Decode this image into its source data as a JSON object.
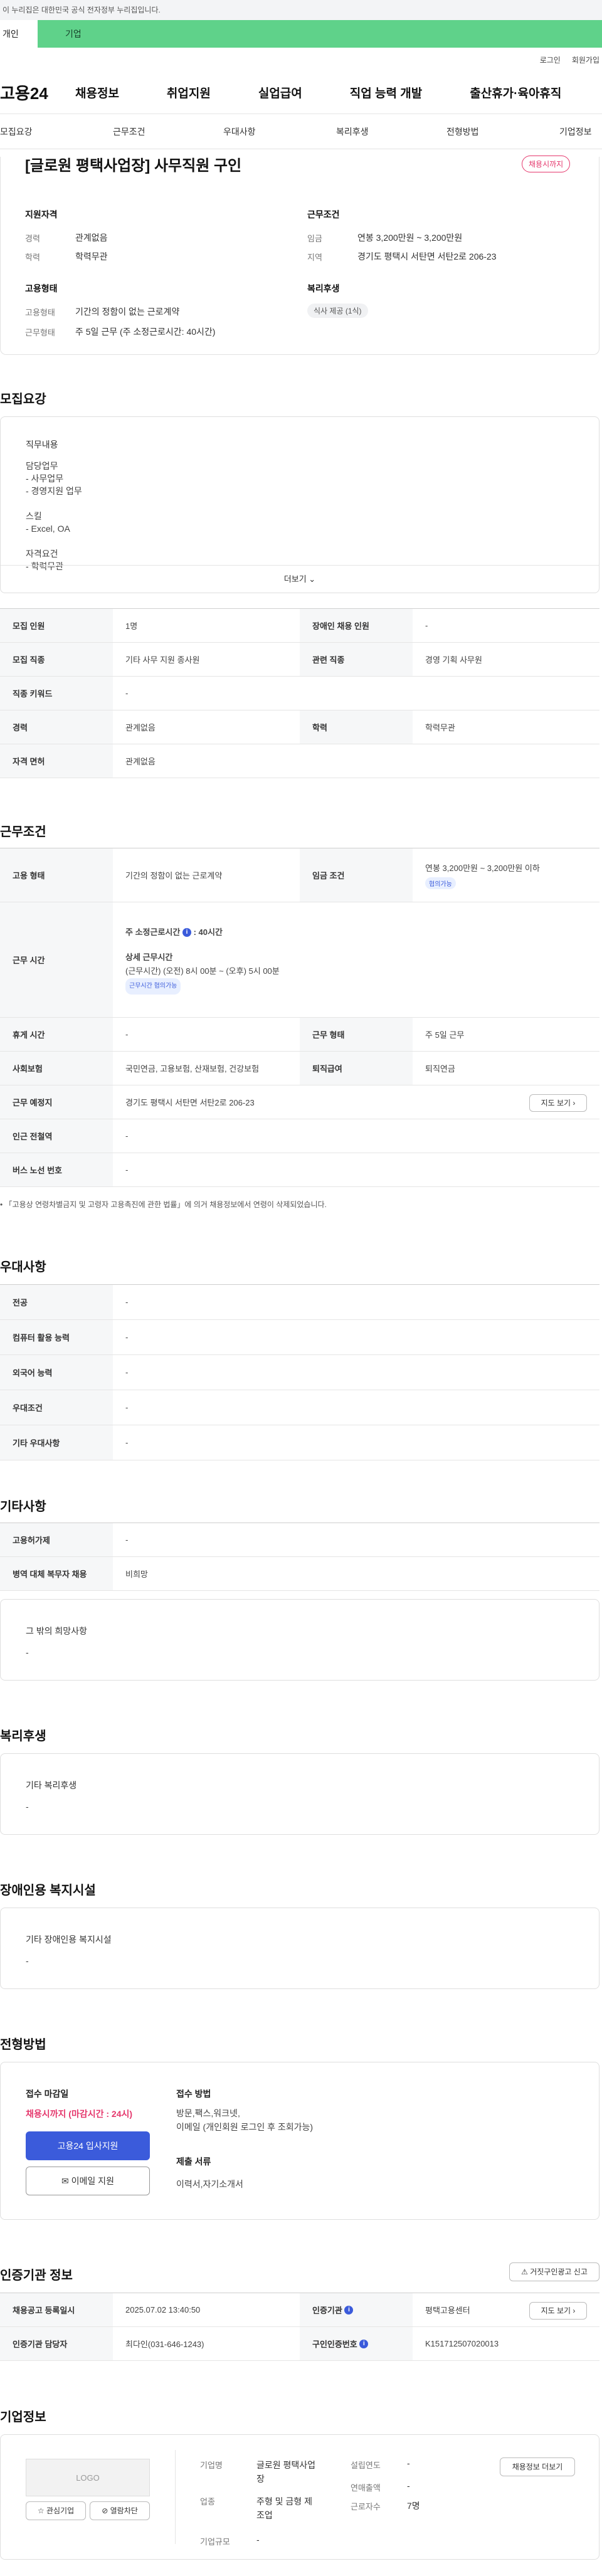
{
  "gov_text": "이 누리집은 대한민국 공식 전자정부 누리집입니다.",
  "tabs": {
    "personal": "개인",
    "company": "기업"
  },
  "util": {
    "login": "로그인",
    "join": "회원가입"
  },
  "site_logo": "고용24",
  "gnb": [
    "채용정보",
    "취업지원",
    "실업급여",
    "직업 능력 개발",
    "출산휴가·육아휴직"
  ],
  "snb": [
    "모집요강",
    "근무조건",
    "우대사항",
    "복리후생",
    "전형방법",
    "기업정보"
  ],
  "job_title": "[글로원 평택사업장] 사무직원 구인",
  "status_badge": "채용시까지",
  "summary": {
    "qual_title": "지원자격",
    "career_k": "경력",
    "career_v": "관계없음",
    "edu_k": "학력",
    "edu_v": "학력무관",
    "cond_title": "근무조건",
    "wage_k": "임금",
    "wage_v": "연봉 3,200만원 ~ 3,200만원",
    "area_k": "지역",
    "area_v": "경기도 평택시 서탄면 서탄2로 206-23",
    "emp_title": "고용형태",
    "emptype_k": "고용형태",
    "emptype_v": "기간의 정함이 없는 근로계약",
    "worktype_k": "근무형태",
    "worktype_v": "주 5일 근무 (주 소정근로시간: 40시간)",
    "welfare_title": "복리후생",
    "welfare_chip": "식사 제공 (1식)"
  },
  "recruit": {
    "title": "모집요강",
    "desc_title": "직무내용",
    "desc_lines": [
      "담당업무",
      "- 사무업무",
      "- 경영지원 업무",
      "",
      "스킬",
      "- Excel, OA",
      "",
      "자격요건",
      "- 학력무관"
    ],
    "more": "더보기",
    "rows": [
      [
        "모집 인원",
        "1명",
        "장애인 채용 인원",
        "-"
      ],
      [
        "모집 직종",
        "기타 사무 지원 종사원",
        "관련 직종",
        "경영 기획 사무원"
      ],
      [
        "직종 키워드",
        "-"
      ],
      [
        "경력",
        "관계없음",
        "학력",
        "학력무관"
      ],
      [
        "자격 면허",
        "관계없음"
      ]
    ]
  },
  "conditions": {
    "title": "근무조건",
    "emp_k": "고용 형태",
    "emp_v": "기간의 정함이 없는 근로계약",
    "wage_k": "임금 조건",
    "wage_v": "연봉 3,200만원 ~ 3,200만원 이하",
    "wage_chip": "협의가능",
    "time_k": "근무 시간",
    "time_main": "주 소정근로시간",
    "time_hours": ": 40시간",
    "time_detail_title": "상세 근무시간",
    "time_detail": "(근무시간) (오전) 8시 00분 ~ (오후) 5시 00분",
    "time_chip": "근무시간 협의가능",
    "break_k": "휴게 시간",
    "break_v": "-",
    "form_k": "근무 형태",
    "form_v": "주 5일 근무",
    "ins_k": "사회보험",
    "ins_v": "국민연금, 고용보험, 산재보험, 건강보험",
    "ret_k": "퇴직급여",
    "ret_v": "퇴직연금",
    "place_k": "근무 예정지",
    "place_v": "경기도 평택시 서탄면 서탄2로 206-23",
    "map_btn": "지도 보기",
    "subway_k": "인근 전철역",
    "subway_v": "-",
    "bus_k": "버스 노선 번호",
    "bus_v": "-",
    "note": "「고용상 연령차별금지 및 고령자 고용촉진에 관한 법률」에 의거 채용정보에서 연령이 삭제되었습니다."
  },
  "pref": {
    "title": "우대사항",
    "rows": [
      [
        "전공",
        "-"
      ],
      [
        "컴퓨터 활용 능력",
        "-"
      ],
      [
        "외국어 능력",
        "-"
      ],
      [
        "우대조건",
        "-"
      ],
      [
        "기타 우대사항",
        "-"
      ]
    ]
  },
  "etc": {
    "title": "기타사항",
    "rows": [
      [
        "고용허가제",
        "-"
      ],
      [
        "병역 대체 복무자 채용",
        "비희망"
      ]
    ],
    "hope_title": "그 밖의 희망사항",
    "hope_v": "-"
  },
  "welfare": {
    "title": "복리후생",
    "box_title": "기타 복리후생",
    "box_v": "-"
  },
  "disabled": {
    "title": "장애인용 복지시설",
    "box_title": "기타 장애인용 복지시설",
    "box_v": "-"
  },
  "process": {
    "title": "전형방법",
    "deadline_title": "접수 마감일",
    "deadline_v": "채용시까지 (마감시간 : 24시)",
    "apply_btn": "고용24 입사지원",
    "email_btn": "이메일 지원",
    "method_title": "접수 방법",
    "method_lines": [
      "방문,팩스,워크넷,",
      "이메일 (개인회원 로그인 후 조회가능)"
    ],
    "docs_title": "제출 서류",
    "docs_v": "이력서,자기소개서"
  },
  "cert": {
    "title": "인증기관 정보",
    "report_btn": "거짓구인광고 신고",
    "rows": [
      [
        "채용공고 등록일시",
        "2025.07.02 13:40:50",
        "인증기관",
        "평택고용센터"
      ],
      [
        "인증기관 담당자",
        "최다인(031-646-1243)",
        "구인인증번호",
        "K151712507020013"
      ]
    ],
    "map_btn": "지도 보기"
  },
  "company": {
    "title": "기업정보",
    "logo": "LOGO",
    "fav_btn": "관심기업",
    "block_btn": "열람차단",
    "info_btn": "채용정보 더보기",
    "name_k": "기업명",
    "name_v": "글로원 평택사업장",
    "found_k": "설립연도",
    "found_v": "-",
    "sales_k": "연매출액",
    "sales_v": "-",
    "ind_k": "업종",
    "ind_v": "주형 및 금형 제조업",
    "emp_k": "근로자수",
    "emp_v": "7명",
    "size_k": "기업규모",
    "size_v": "-"
  }
}
